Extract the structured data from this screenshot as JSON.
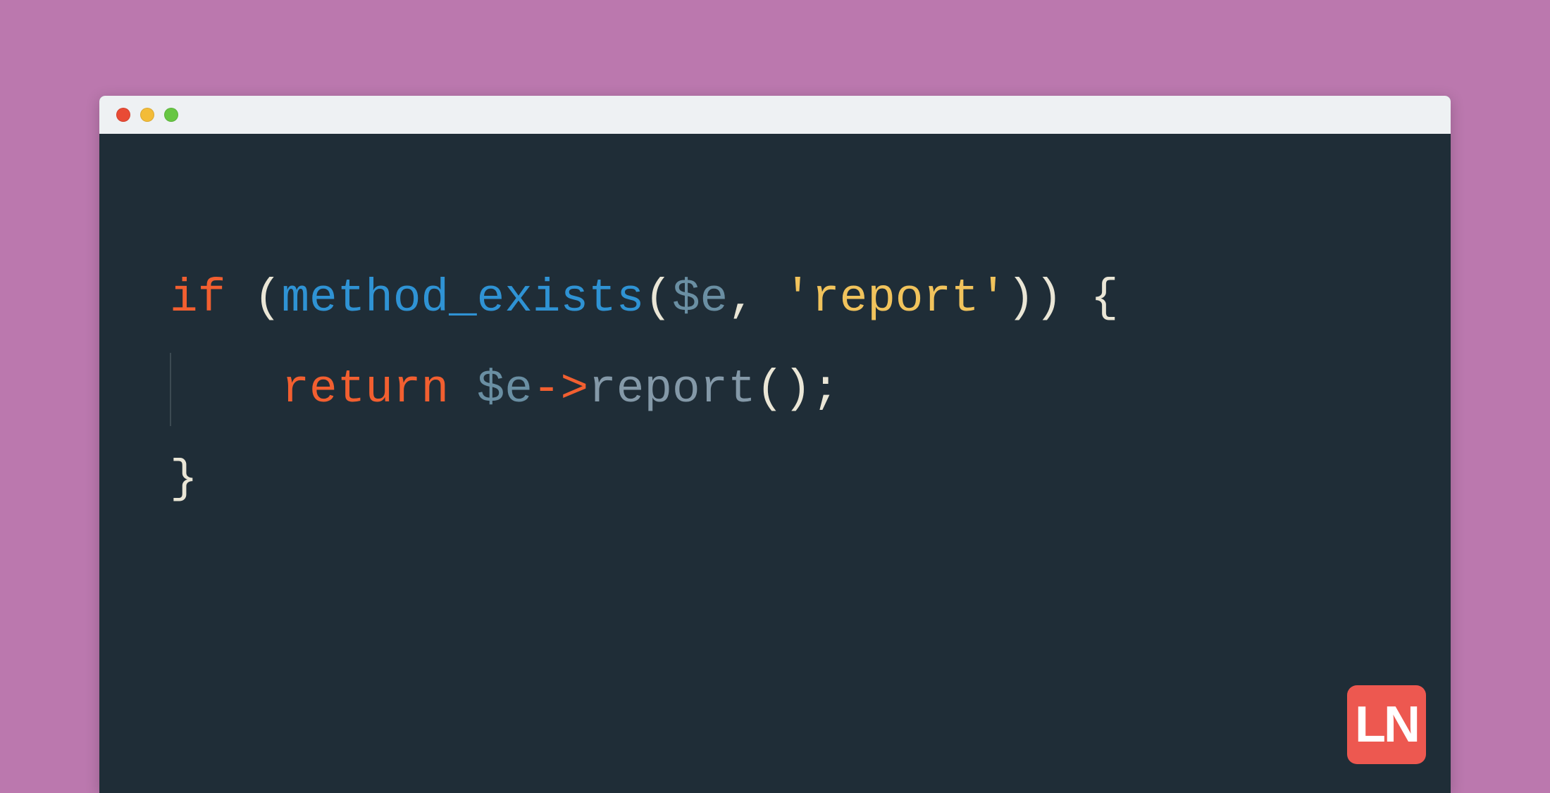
{
  "code": {
    "line1": {
      "if": "if",
      "open_paren": " (",
      "func": "method_exists",
      "args_open": "(",
      "var": "$e",
      "comma": ", ",
      "string": "'report'",
      "args_close": "))",
      "brace": " {"
    },
    "line2": {
      "indent": "    ",
      "return": "return",
      "space": " ",
      "var": "$e",
      "arrow": "->",
      "method": "report",
      "call": "();"
    },
    "line3": {
      "close_brace": "}"
    }
  },
  "logo": {
    "text": "LN"
  }
}
